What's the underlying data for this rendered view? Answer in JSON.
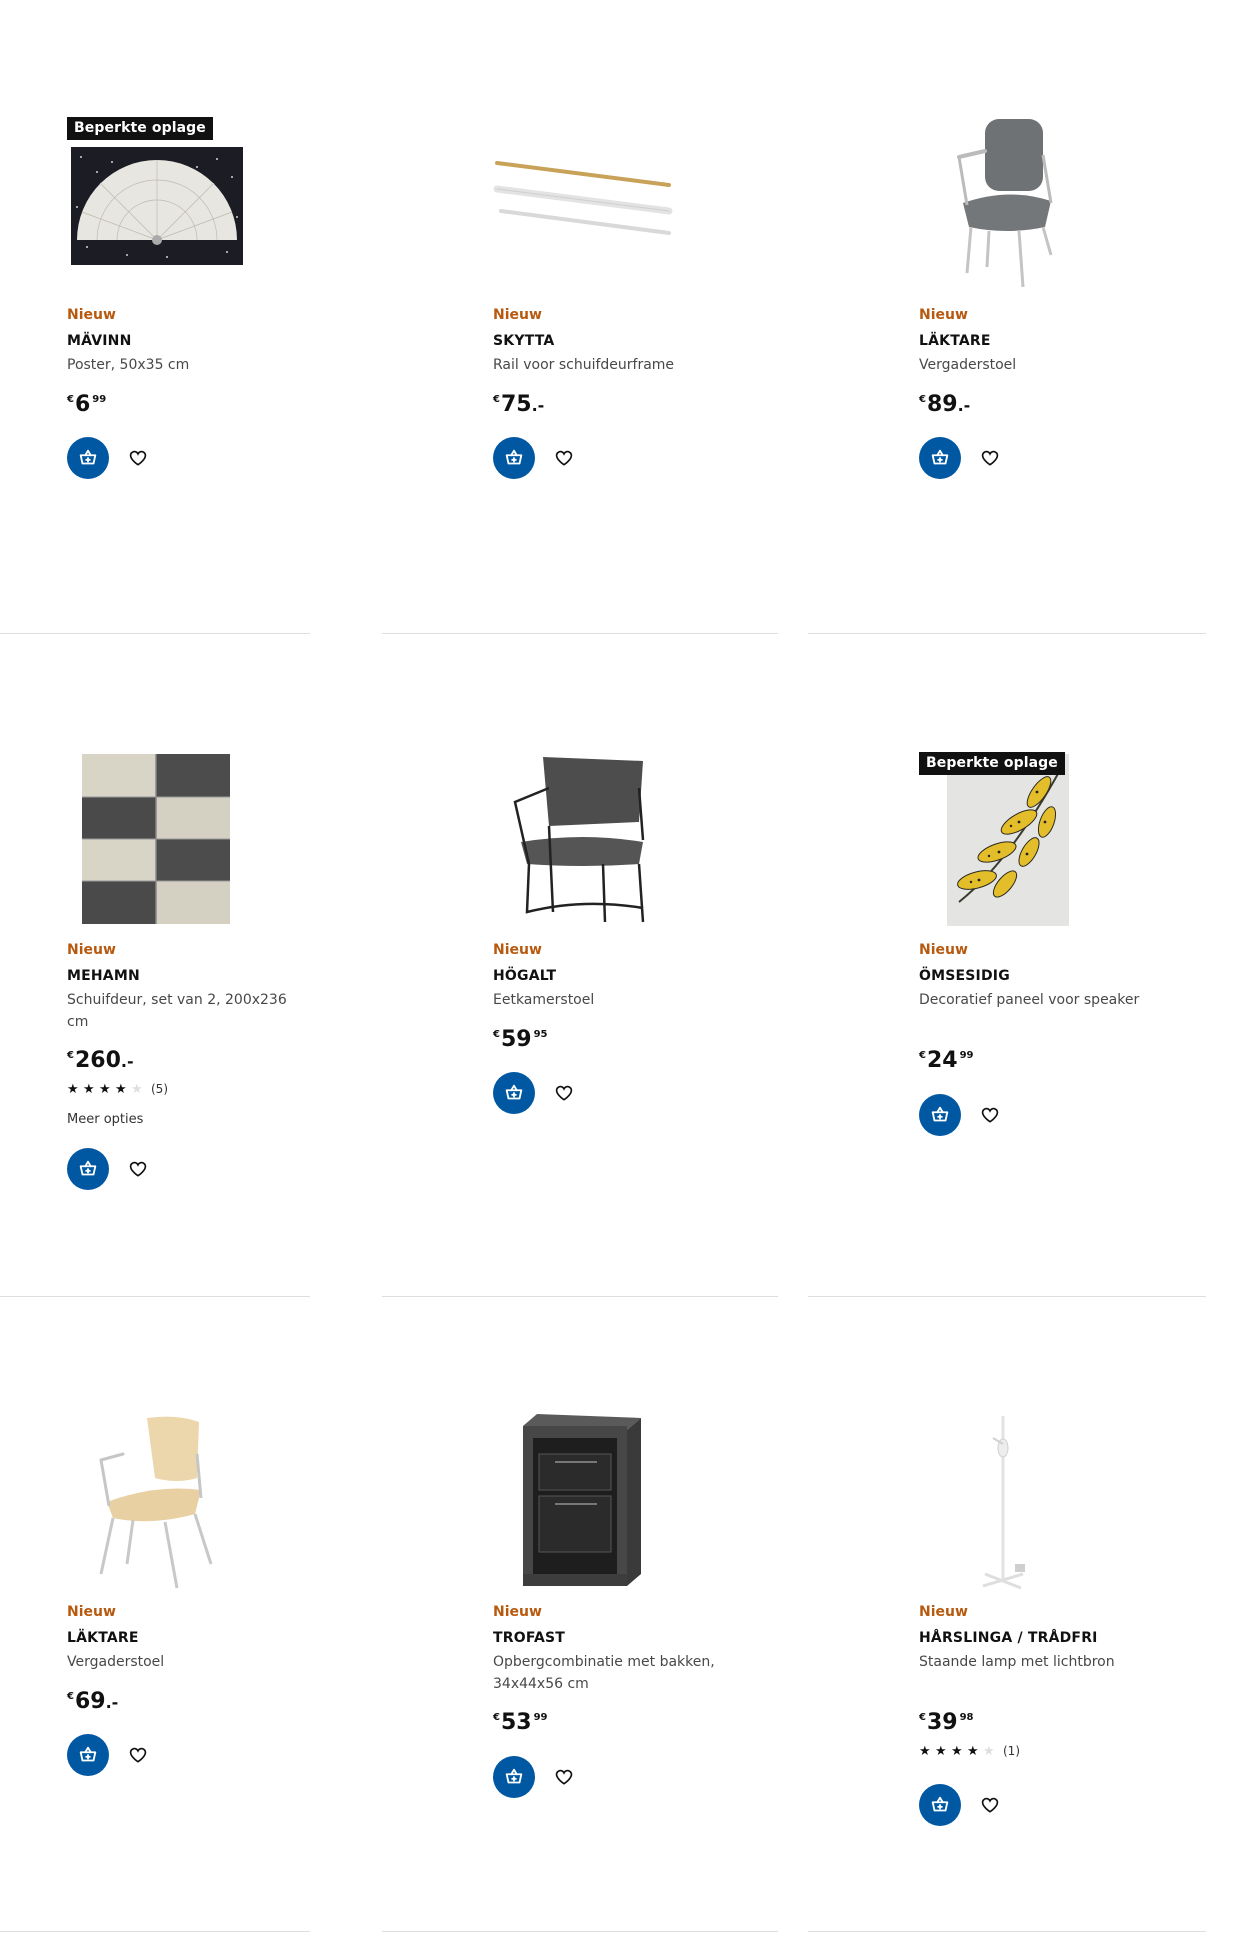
{
  "products": [
    {
      "badge": "Beperkte oplage",
      "new_label": "Nieuw",
      "name": "MÄVINN",
      "description": "Poster, 50x35 cm",
      "price": {
        "currency": "€",
        "integer": "6",
        "decimal": "99"
      },
      "image_icon": "poster-image"
    },
    {
      "new_label": "Nieuw",
      "name": "SKYTTA",
      "description": "Rail voor schuifdeurframe",
      "price": {
        "currency": "€",
        "integer": "75",
        "decimal": ".-"
      },
      "image_icon": "rail-image"
    },
    {
      "new_label": "Nieuw",
      "name": "LÄKTARE",
      "description": "Vergaderstoel",
      "price": {
        "currency": "€",
        "integer": "89",
        "decimal": ".-"
      },
      "image_icon": "grey-chair-image"
    },
    {
      "new_label": "Nieuw",
      "name": "MEHAMN",
      "description": "Schuifdeur, set van 2, 200x236 cm",
      "price": {
        "currency": "€",
        "integer": "260",
        "decimal": ".-"
      },
      "rating": {
        "stars": 4,
        "max": 5,
        "count": "(5)"
      },
      "more_options": "Meer opties",
      "image_icon": "sliding-door-image"
    },
    {
      "new_label": "Nieuw",
      "name": "HÖGALT",
      "description": "Eetkamerstoel",
      "price": {
        "currency": "€",
        "integer": "59",
        "decimal": "95"
      },
      "image_icon": "dining-chair-image"
    },
    {
      "badge": "Beperkte oplage",
      "new_label": "Nieuw",
      "name": "ÖMSESIDIG",
      "description": "Decoratief paneel voor speaker",
      "price": {
        "currency": "€",
        "integer": "24",
        "decimal": "99"
      },
      "image_icon": "leaf-panel-image"
    },
    {
      "new_label": "Nieuw",
      "name": "LÄKTARE",
      "description": "Vergaderstoel",
      "price": {
        "currency": "€",
        "integer": "69",
        "decimal": ".-"
      },
      "image_icon": "birch-chair-image"
    },
    {
      "new_label": "Nieuw",
      "name": "TROFAST",
      "description": "Opbergcombinatie met bakken, 34x44x56 cm",
      "price": {
        "currency": "€",
        "integer": "53",
        "decimal": "99"
      },
      "image_icon": "storage-image"
    },
    {
      "new_label": "Nieuw",
      "name": "HÅRSLINGA / TRÅDFRI",
      "description": "Staande lamp met lichtbron",
      "price": {
        "currency": "€",
        "integer": "39",
        "decimal": "98"
      },
      "rating": {
        "stars": 4,
        "max": 5,
        "count": "(1)"
      },
      "image_icon": "floor-lamp-image"
    }
  ],
  "colors": {
    "accent": "#0058a3",
    "new_label": "#b75a10",
    "badge_bg": "#111111",
    "divider": "#dfdfdf"
  },
  "icons": {
    "cart": "add-to-cart-icon",
    "favorite": "heart-icon",
    "star": "star-icon"
  }
}
